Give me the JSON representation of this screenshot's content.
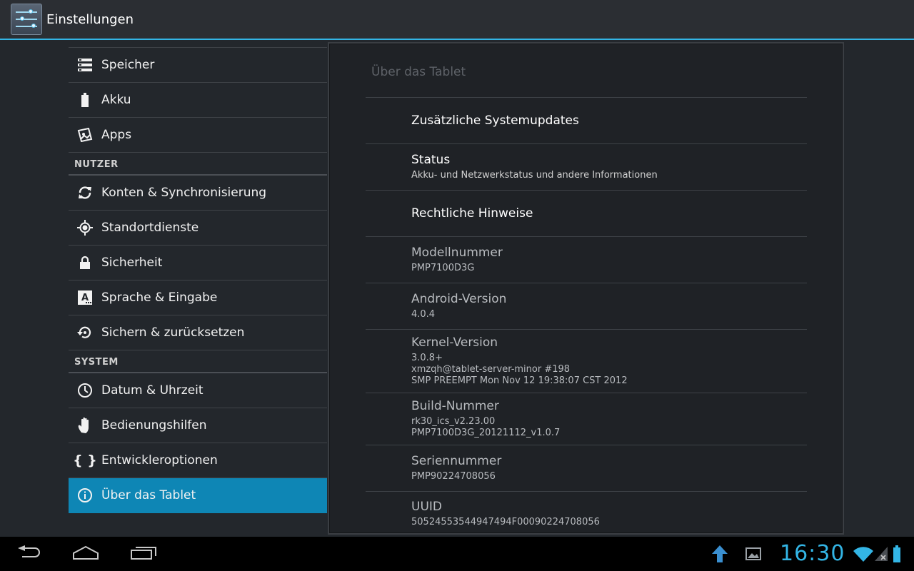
{
  "actionbar": {
    "title": "Einstellungen",
    "icon": "settings-sliders-icon"
  },
  "sidebar": {
    "top_items": [
      {
        "label": "Speicher",
        "icon": "storage-icon"
      },
      {
        "label": "Akku",
        "icon": "battery-icon"
      },
      {
        "label": "Apps",
        "icon": "apps-icon"
      }
    ],
    "header_user": "NUTZER",
    "user_items": [
      {
        "label": "Konten & Synchronisierung",
        "icon": "sync-icon"
      },
      {
        "label": "Standortdienste",
        "icon": "location-icon"
      },
      {
        "label": "Sicherheit",
        "icon": "lock-icon"
      },
      {
        "label": "Sprache & Eingabe",
        "icon": "language-icon"
      },
      {
        "label": "Sichern & zurücksetzen",
        "icon": "backup-icon"
      }
    ],
    "header_system": "SYSTEM",
    "system_items": [
      {
        "label": "Datum & Uhrzeit",
        "icon": "clock-icon"
      },
      {
        "label": "Bedienungshilfen",
        "icon": "hand-icon"
      },
      {
        "label": "Entwickleroptionen",
        "icon": "braces-icon"
      },
      {
        "label": "Über das Tablet",
        "icon": "info-icon",
        "selected": true
      }
    ]
  },
  "panel": {
    "title": "Über das Tablet",
    "rows": [
      {
        "title": "Zusätzliche Systemupdates"
      },
      {
        "title": "Status",
        "summary": "Akku- und Netzwerkstatus und andere Informationen"
      },
      {
        "title": "Rechtliche Hinweise"
      },
      {
        "title": "Modellnummer",
        "summary": "PMP7100D3G"
      },
      {
        "title": "Android-Version",
        "summary": "4.0.4"
      },
      {
        "title": "Kernel-Version",
        "summary": "3.0.8+",
        "summary2": "xmzqh@tablet-server-minor #198",
        "summary3": "SMP PREEMPT Mon Nov 12 19:38:07 CST 2012"
      },
      {
        "title": "Build-Nummer",
        "summary": "rk30_ics_v2.23.00",
        "summary2": "PMP7100D3G_20121112_v1.0.7"
      },
      {
        "title": "Seriennummer",
        "summary": "PMP90224708056"
      },
      {
        "title": "UUID",
        "summary": "50524553544947494F00090224708056"
      }
    ]
  },
  "navbar": {
    "back": "back-icon",
    "home": "home-icon",
    "recents": "recent-apps-icon",
    "clock": "16:30",
    "status_icons": [
      "upload-icon",
      "gallery-icon",
      "wifi-icon",
      "no-signal-icon",
      "battery-status-icon"
    ]
  },
  "colors": {
    "accent": "#33b5e5",
    "selected": "#0e86b5"
  }
}
